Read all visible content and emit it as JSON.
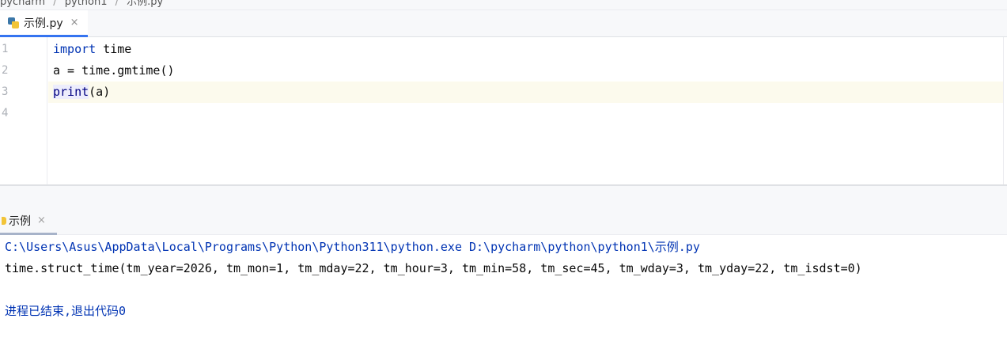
{
  "breadcrumb": {
    "items": [
      "pycharm",
      "python1",
      "示例.py"
    ]
  },
  "editor_tab": {
    "label": "示例.py",
    "close": "×"
  },
  "editor": {
    "line_numbers": [
      "1",
      "2",
      "3",
      "4"
    ],
    "lines": [
      {
        "keyword": "import",
        "rest": " time"
      },
      {
        "text": "a = time.gmtime()"
      },
      {
        "builtin": "print",
        "rest": "(a)"
      },
      {
        "text": ""
      }
    ]
  },
  "run": {
    "tab_label": "示例",
    "close": "×",
    "console": {
      "command": "C:\\Users\\Asus\\AppData\\Local\\Programs\\Python\\Python311\\python.exe D:\\pycharm\\python\\python1\\示例.py",
      "output": "time.struct_time(tm_year=2026, tm_mon=1, tm_mday=22, tm_hour=3, tm_min=58, tm_sec=45, tm_wday=3, tm_yday=22, tm_isdst=0)",
      "exit_message": "进程已结束,退出代码0"
    }
  },
  "colors": {
    "accent": "#3574f0",
    "keyword": "#0033b3",
    "current_line": "#fcfaed"
  }
}
